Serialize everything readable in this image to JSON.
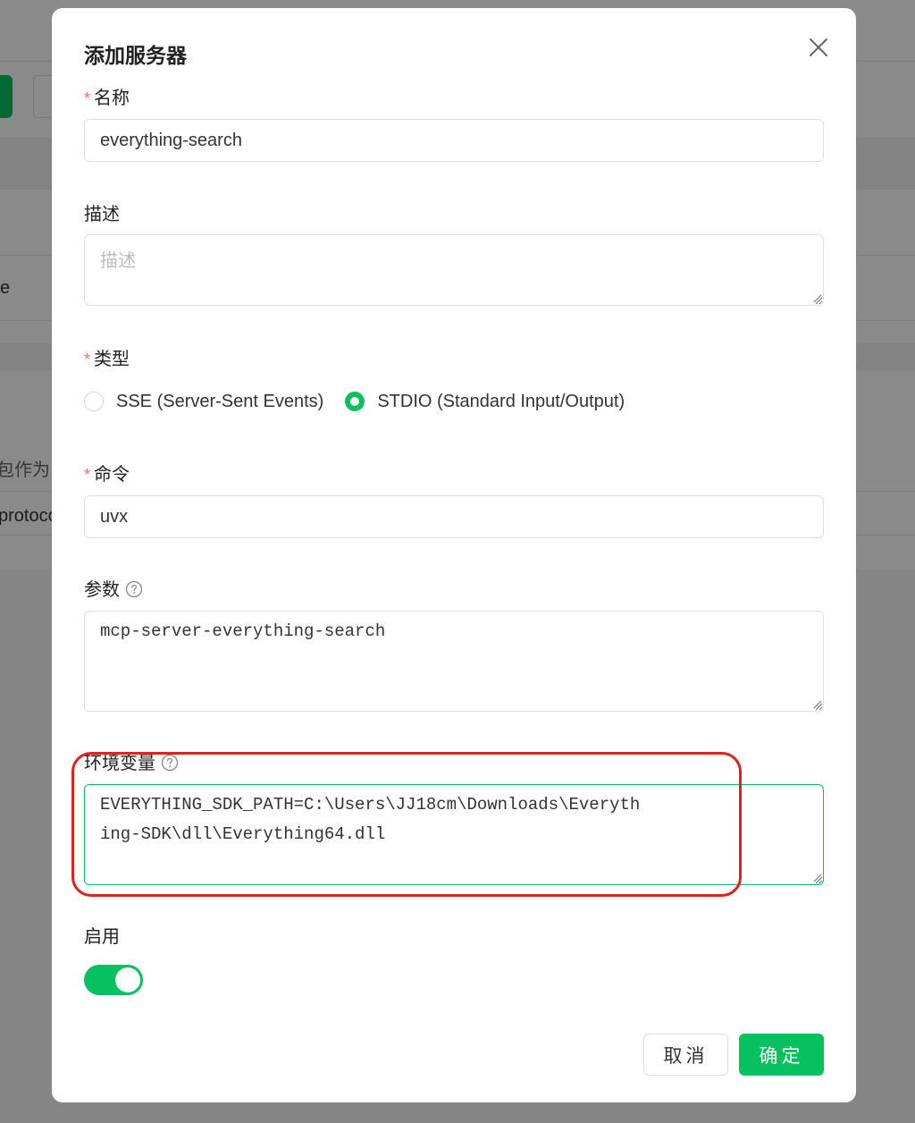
{
  "background": {
    "row1_text": "e",
    "row2_text": "包作为",
    "row3_text": "protoco"
  },
  "dialog": {
    "title": "添加服务器",
    "close_icon": "close-icon",
    "required_mark": "*"
  },
  "form": {
    "name": {
      "label": "名称",
      "value": "everything-search"
    },
    "description": {
      "label": "描述",
      "placeholder": "描述",
      "value": ""
    },
    "type": {
      "label": "类型",
      "options": [
        {
          "label": "SSE (Server-Sent Events)",
          "checked": false
        },
        {
          "label": "STDIO (Standard Input/Output)",
          "checked": true
        }
      ]
    },
    "command": {
      "label": "命令",
      "value": "uvx"
    },
    "args": {
      "label": "参数",
      "value": "mcp-server-everything-search"
    },
    "env": {
      "label": "环境变量",
      "value": "EVERYTHING_SDK_PATH=C:\\Users\\JJ18cm\\Downloads\\Everything-SDK\\dll\\Everything64.dll"
    },
    "enabled": {
      "label": "启用",
      "value": true
    }
  },
  "buttons": {
    "cancel": "取消",
    "ok": "确定"
  },
  "colors": {
    "accent": "#07c160",
    "required": "#f56c6c",
    "annotation": "#e0221c"
  }
}
